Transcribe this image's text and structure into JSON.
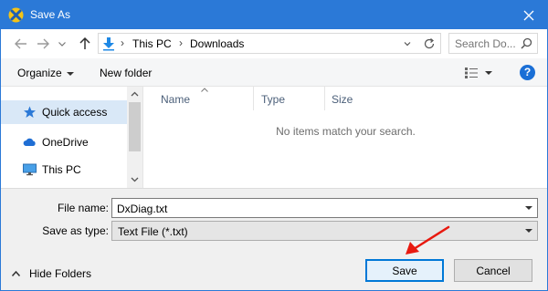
{
  "window": {
    "title": "Save As",
    "accent": "#2b79d7"
  },
  "titlebar": {
    "app_icon": "dxdiag-icon",
    "close_icon": "close-icon"
  },
  "nav": {
    "back_icon": "arrow-left-icon",
    "forward_icon": "arrow-right-icon",
    "recent_icon": "chevron-down-icon",
    "up_icon": "arrow-up-icon",
    "breadcrumbs": [
      "This PC",
      "Downloads"
    ],
    "search_placeholder": "Search Do..."
  },
  "commandbar": {
    "organize_label": "Organize",
    "new_folder_label": "New folder",
    "views_icon": "details-view-icon",
    "help_label": "?"
  },
  "navpane": {
    "items": [
      {
        "label": "Quick access",
        "icon": "star-icon",
        "selected": true
      },
      {
        "label": "OneDrive",
        "icon": "cloud-icon",
        "selected": false
      },
      {
        "label": "This PC",
        "icon": "monitor-icon",
        "selected": false
      }
    ]
  },
  "filelist": {
    "columns": [
      "Name",
      "Type",
      "Size"
    ],
    "empty_message": "No items match your search."
  },
  "form": {
    "filename_label": "File name:",
    "filename_value": "DxDiag.txt",
    "savetype_label": "Save as type:",
    "savetype_value": "Text File (*.txt)"
  },
  "footer": {
    "hide_folders_label": "Hide Folders",
    "save_label": "Save",
    "cancel_label": "Cancel"
  },
  "annotation": {
    "arrow_color": "#e8190f"
  }
}
